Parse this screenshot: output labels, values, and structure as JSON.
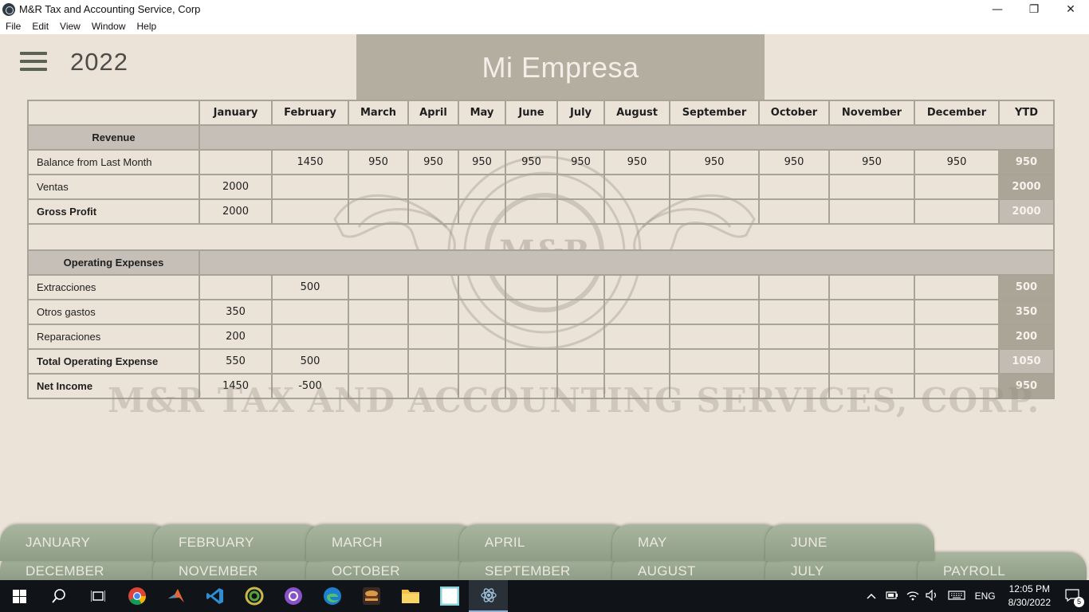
{
  "window": {
    "title": "M&R Tax and Accounting Service, Corp",
    "minimize": "—",
    "restore": "❐",
    "close": "✕"
  },
  "menu": [
    "File",
    "Edit",
    "View",
    "Window",
    "Help"
  ],
  "header": {
    "year": "2022",
    "company": "Mi Empresa"
  },
  "watermark": {
    "text": "M&R TAX AND ACCOUNTING SERVICES, CORP.",
    "seal_text": "M&R"
  },
  "table": {
    "months": [
      "January",
      "February",
      "March",
      "April",
      "May",
      "June",
      "July",
      "August",
      "September",
      "October",
      "November",
      "December",
      "YTD"
    ],
    "revenue_section": "Revenue",
    "balance_label": "Balance from Last Month",
    "balance": [
      "",
      "1450",
      "950",
      "950",
      "950",
      "950",
      "950",
      "950",
      "950",
      "950",
      "950",
      "950",
      "950"
    ],
    "ventas_label": "Ventas",
    "ventas": [
      "2000",
      "",
      "",
      "",
      "",
      "",
      "",
      "",
      "",
      "",
      "",
      "",
      "2000"
    ],
    "gross_label": "Gross Profit",
    "gross": [
      "2000",
      "",
      "",
      "",
      "",
      "",
      "",
      "",
      "",
      "",
      "",
      "",
      "2000"
    ],
    "opex_section": "Operating Expenses",
    "extracciones_label": "Extracciones",
    "extracciones": [
      "",
      "500",
      "",
      "",
      "",
      "",
      "",
      "",
      "",
      "",
      "",
      "",
      "500"
    ],
    "otros_label": "Otros gastos",
    "otros": [
      "350",
      "",
      "",
      "",
      "",
      "",
      "",
      "",
      "",
      "",
      "",
      "",
      "350"
    ],
    "reparaciones_label": "Reparaciones",
    "reparaciones": [
      "200",
      "",
      "",
      "",
      "",
      "",
      "",
      "",
      "",
      "",
      "",
      "",
      "200"
    ],
    "total_opex_label": "Total Operating Expense",
    "total_opex": [
      "550",
      "500",
      "",
      "",
      "",
      "",
      "",
      "",
      "",
      "",
      "",
      "",
      "1050"
    ],
    "net_label": "Net Income",
    "net": [
      "1450",
      "-500",
      "",
      "",
      "",
      "",
      "",
      "",
      "",
      "",
      "",
      "",
      "950"
    ]
  },
  "tabs": {
    "row1": [
      "JANUARY",
      "FEBRUARY",
      "MARCH",
      "APRIL",
      "MAY",
      "JUNE"
    ],
    "row2": [
      "DECEMBER",
      "NOVEMBER",
      "OCTOBER",
      "SEPTEMBER",
      "AUGUST",
      "JULY",
      "PAYROLL"
    ]
  },
  "taskbar": {
    "icons": [
      "windows-start-icon",
      "search-icon",
      "task-view-icon",
      "chrome-icon",
      "matlab-icon",
      "vscode-icon",
      "gnu-icon",
      "github-desktop-icon",
      "edge-icon",
      "burger-app-icon",
      "file-explorer-icon",
      "notepad-icon",
      "electron-app-icon"
    ],
    "language": "ENG",
    "time": "12:05 PM",
    "date": "8/30/2022",
    "notifications": "5"
  }
}
